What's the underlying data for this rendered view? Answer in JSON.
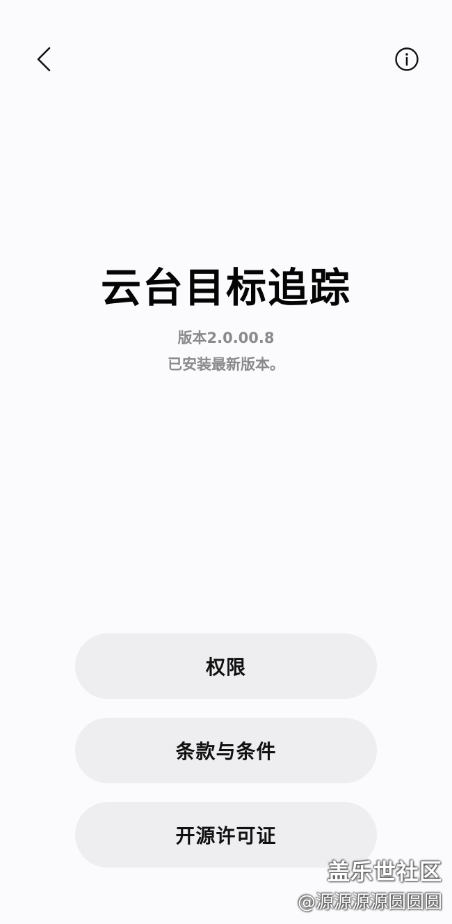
{
  "header": {
    "back_icon": "chevron-left-icon",
    "info_icon": "info-circle-icon"
  },
  "app": {
    "title": "云台目标追踪",
    "version": "版本2.0.00.8",
    "status": "已安装最新版本。"
  },
  "buttons": {
    "permissions": "权限",
    "terms": "条款与条件",
    "license": "开源许可证"
  },
  "watermark": {
    "site": "盖乐世社区",
    "user": "@源源源源圆圆圆"
  },
  "colors": {
    "background": "#fbfafd",
    "button_bg": "#eeedf0",
    "title": "#050505",
    "secondary_text": "#8a8a8d"
  }
}
